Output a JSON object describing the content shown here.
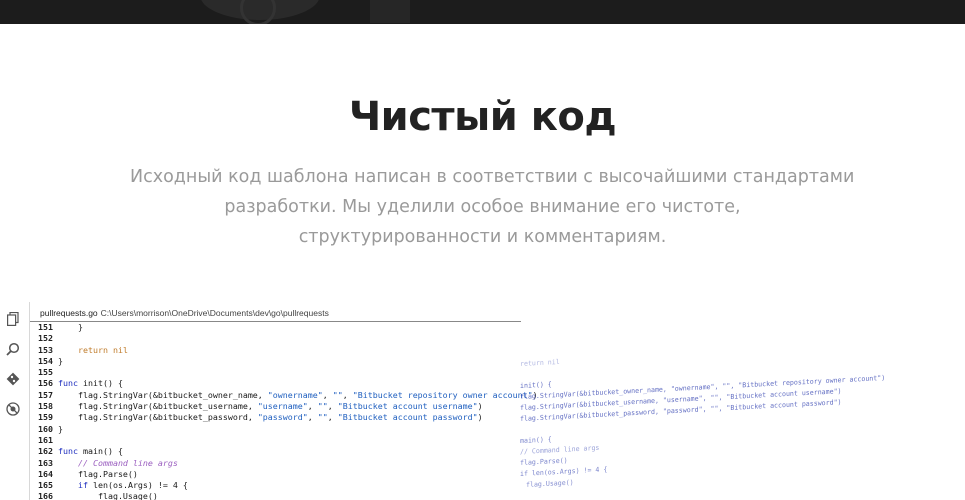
{
  "section": {
    "title": "Чистый код",
    "description_lines": [
      "Исходный код шаблона написан в соответствии с высочайшими стандартами",
      "разработки. Мы уделили особое внимание его чистоте,",
      "структурированности и комментариям."
    ]
  },
  "editor": {
    "file_name": "pullrequests.go",
    "file_path": "C:\\Users\\morrison\\OneDrive\\Documents\\dev\\go\\pullrequests",
    "activity_icons": [
      "files-icon",
      "search-icon",
      "git-icon",
      "debug-icon"
    ],
    "lines": [
      {
        "n": "151",
        "code": "    }"
      },
      {
        "n": "152",
        "code": ""
      },
      {
        "n": "153",
        "code": "    return nil"
      },
      {
        "n": "154",
        "code": "}"
      },
      {
        "n": "155",
        "code": ""
      },
      {
        "n": "156",
        "code": "func init() {"
      },
      {
        "n": "157",
        "code": "    flag.StringVar(&bitbucket_owner_name, \"ownername\", \"\", \"Bitbucket repository owner account\")"
      },
      {
        "n": "158",
        "code": "    flag.StringVar(&bitbucket_username, \"username\", \"\", \"Bitbucket account username\")"
      },
      {
        "n": "159",
        "code": "    flag.StringVar(&bitbucket_password, \"password\", \"\", \"Bitbucket account password\")"
      },
      {
        "n": "160",
        "code": "}"
      },
      {
        "n": "161",
        "code": ""
      },
      {
        "n": "162",
        "code": "func main() {"
      },
      {
        "n": "163",
        "code": "    // Command line args"
      },
      {
        "n": "164",
        "code": "    flag.Parse()"
      },
      {
        "n": "165",
        "code": "    if len(os.Args) != 4 {"
      },
      {
        "n": "166",
        "code": "        flag.Usage()"
      }
    ],
    "ghost_lines": [
      "return nil",
      "init() {",
      "flag.StringVar(&bitbucket_owner_name, \"ownername\", \"\", \"Bitbucket repository owner account\")",
      "flag.StringVar(&bitbucket_username, \"username\", \"\", \"Bitbucket account username\")",
      "flag.StringVar(&bitbucket_password, \"password\", \"\", \"Bitbucket account password\")",
      "main() {",
      "// Command line args",
      "flag.Parse()",
      "if len(os.Args) != 4 {",
      "flag.Usage()"
    ]
  }
}
